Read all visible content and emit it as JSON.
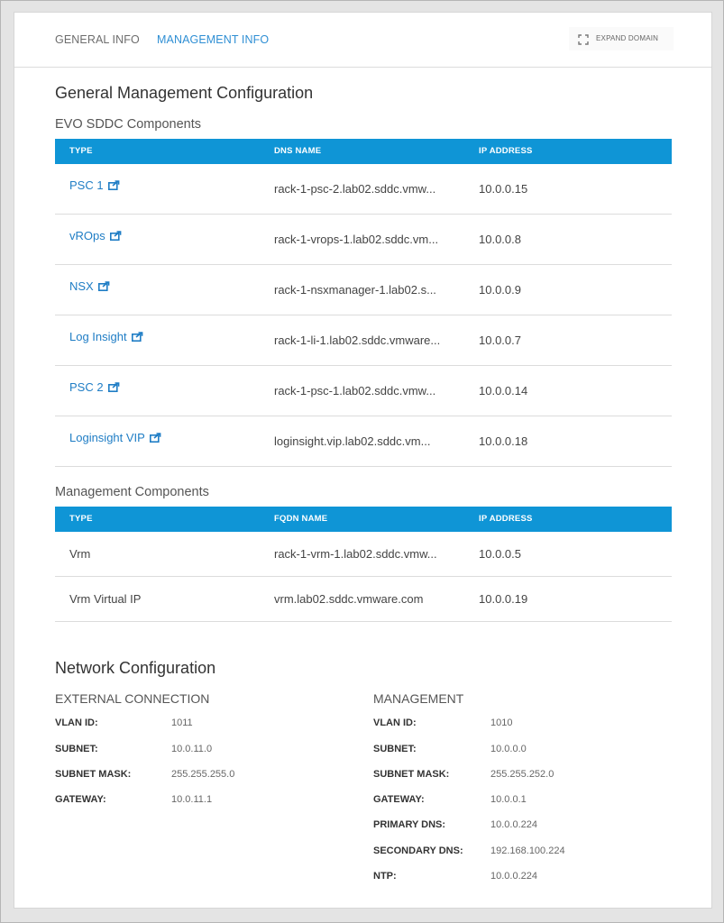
{
  "tabs": [
    {
      "label": "GENERAL INFO",
      "active": false
    },
    {
      "label": "MANAGEMENT INFO",
      "active": true
    }
  ],
  "expand_label": "EXPAND DOMAIN",
  "general_title": "General Management Configuration",
  "evo": {
    "title": "EVO SDDC Components",
    "headers": [
      "TYPE",
      "DNS NAME",
      "IP ADDRESS"
    ],
    "rows": [
      {
        "type": "PSC 1",
        "dns": "rack-1-psc-2.lab02.sddc.vmw...",
        "ip": "10.0.0.15"
      },
      {
        "type": "vROps",
        "dns": "rack-1-vrops-1.lab02.sddc.vm...",
        "ip": "10.0.0.8"
      },
      {
        "type": "NSX",
        "dns": "rack-1-nsxmanager-1.lab02.s...",
        "ip": "10.0.0.9"
      },
      {
        "type": "Log Insight",
        "dns": "rack-1-li-1.lab02.sddc.vmware...",
        "ip": "10.0.0.7"
      },
      {
        "type": "PSC 2",
        "dns": "rack-1-psc-1.lab02.sddc.vmw...",
        "ip": "10.0.0.14"
      },
      {
        "type": "Loginsight VIP",
        "dns": "loginsight.vip.lab02.sddc.vm...",
        "ip": "10.0.0.18"
      }
    ]
  },
  "mgmt": {
    "title": "Management Components",
    "headers": [
      "TYPE",
      "FQDN NAME",
      "IP ADDRESS"
    ],
    "rows": [
      {
        "type": "Vrm",
        "fqdn": "rack-1-vrm-1.lab02.sddc.vmw...",
        "ip": "10.0.0.5"
      },
      {
        "type": "Vrm Virtual IP",
        "fqdn": "vrm.lab02.sddc.vmware.com",
        "ip": "10.0.0.19"
      }
    ]
  },
  "network": {
    "title": "Network Configuration",
    "external": {
      "title": "EXTERNAL CONNECTION",
      "items": [
        {
          "label": "VLAN ID:",
          "value": "1011"
        },
        {
          "label": "SUBNET:",
          "value": "10.0.11.0"
        },
        {
          "label": "SUBNET MASK:",
          "value": "255.255.255.0"
        },
        {
          "label": "GATEWAY:",
          "value": "10.0.11.1"
        }
      ]
    },
    "management": {
      "title": "MANAGEMENT",
      "items": [
        {
          "label": "VLAN ID:",
          "value": "1010"
        },
        {
          "label": "SUBNET:",
          "value": "10.0.0.0"
        },
        {
          "label": "SUBNET MASK:",
          "value": "255.255.252.0"
        },
        {
          "label": "GATEWAY:",
          "value": "10.0.0.1"
        },
        {
          "label": "PRIMARY DNS:",
          "value": "10.0.0.224"
        },
        {
          "label": "SECONDARY DNS:",
          "value": "192.168.100.224"
        },
        {
          "label": "NTP:",
          "value": "10.0.0.224"
        }
      ]
    }
  },
  "colors": {
    "accent": "#0f95d6",
    "link": "#1f7dc5",
    "active_tab": "#2f8fd4"
  }
}
